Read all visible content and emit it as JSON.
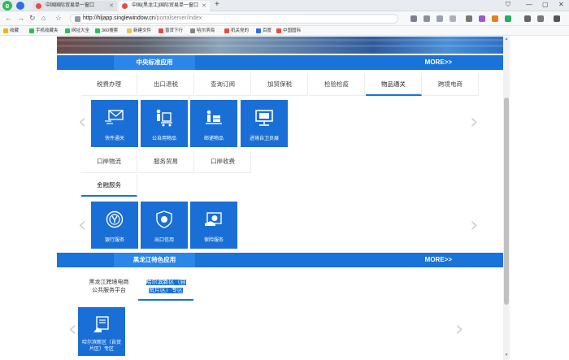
{
  "browser": {
    "tabs": [
      {
        "title": "中国国际贸易单一窗口",
        "active": false
      },
      {
        "title": "中国(黑龙江)国际贸易单一窗口",
        "active": true
      }
    ],
    "new_tab": "+",
    "window_controls": [
      "⛉",
      "—",
      "▢",
      "✕"
    ],
    "url_host": "http://hljapp.singlewindow.cn",
    "url_path": "/portalserver/index",
    "bookmarks": [
      {
        "label": "收藏",
        "color": "#f5b400"
      },
      {
        "label": "手机收藏夹",
        "color": "#2ebc5a"
      },
      {
        "label": "网址大全",
        "color": "#2ebc5a"
      },
      {
        "label": "360搜索",
        "color": "#2ebc5a"
      },
      {
        "label": "新建文件",
        "color": "#f0c24a"
      },
      {
        "label": "普货下行",
        "color": "#e74c3c"
      },
      {
        "label": "哈尔滨海",
        "color": "#888888"
      },
      {
        "label": "机关党的",
        "color": "#e74c3c"
      },
      {
        "label": "百度",
        "color": "#2f6fe0"
      },
      {
        "label": "中国国际",
        "color": "#e74c3c"
      }
    ]
  },
  "central": {
    "title": "中央标准应用",
    "more": "MORE>>",
    "tabs_row1": [
      "税费办理",
      "出口退税",
      "查询订阅",
      "加贸保税",
      "检验检疫",
      "物品通关",
      "跨境电商"
    ],
    "active_tab": "物品通关",
    "tiles_row1": [
      {
        "label": "快件通关",
        "icon": "envelope-icon"
      },
      {
        "label": "公自用物品",
        "icon": "luggage-cart-icon"
      },
      {
        "label": "邮递物品",
        "icon": "parcel-icon"
      },
      {
        "label": "进境自卫员展",
        "icon": "monitor-icon"
      }
    ],
    "tabs_row2": [
      "口岸物流",
      "服务贸易",
      "口岸收费"
    ],
    "tabs_row3": [
      "金融服务"
    ],
    "tiles_row2": [
      {
        "label": "银行服务",
        "icon": "bank-icon"
      },
      {
        "label": "出口信用",
        "icon": "shield-icon"
      },
      {
        "label": "保险服务",
        "icon": "insurance-icon"
      }
    ]
  },
  "heilongjiang": {
    "title": "黑龙江特色应用",
    "more": "MORE>>",
    "tabs": [
      {
        "line1": "黑龙江跨境电商",
        "line2": "公共服务平台"
      },
      {
        "line1": "哈尔滨新区（自",
        "line2": "贸片区）专区"
      }
    ],
    "tile": {
      "line1": "哈尔滨新区（自贸",
      "line2": "片区）专区",
      "icon": "document-icon"
    }
  },
  "carousel": {
    "prev": "‹",
    "next": "›"
  },
  "colors": {
    "primary": "#1a73d8",
    "tile": "#1a6fd6"
  }
}
